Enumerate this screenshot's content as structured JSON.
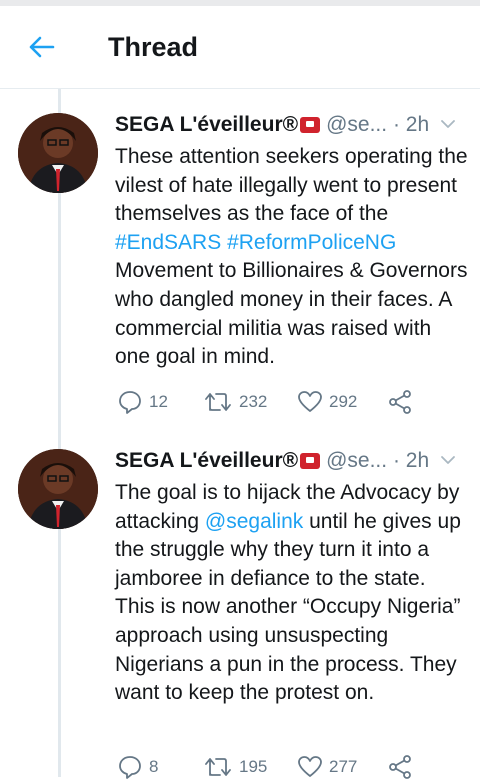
{
  "header": {
    "title": "Thread"
  },
  "tweets": [
    {
      "name": "SEGA L'éveilleur®",
      "handle": "@se...",
      "time": "· 2h",
      "body": [
        {
          "text": "These attention seekers operating the vilest of hate illegally went to present themselves as the face of the "
        },
        {
          "text": "#EndSARS #ReformPoliceNG",
          "link": true
        },
        {
          "text": " Movement to Billionaires & Governors who dangled money in their faces. A commercial militia was raised with one goal in mind."
        }
      ],
      "replies": "12",
      "retweets": "232",
      "likes": "292"
    },
    {
      "name": "SEGA L'éveilleur®",
      "handle": "@se...",
      "time": "· 2h",
      "body": [
        {
          "text": "The goal is to hijack the Advocacy by attacking "
        },
        {
          "text": "@segalink",
          "link": true
        },
        {
          "text": " until he gives up the struggle why they turn it into a jamboree in defiance to the state. This is now another “Occupy Nigeria” approach  using unsuspecting Nigerians a pun in the process. They want to keep the protest on."
        }
      ],
      "replies": "8",
      "retweets": "195",
      "likes": "277"
    }
  ],
  "icons": {
    "back": "arrow-left-icon",
    "caret": "chevron-down-icon",
    "reply": "reply-icon",
    "retweet": "retweet-icon",
    "like": "heart-icon",
    "share": "share-icon"
  },
  "colors": {
    "accent": "#1da1f2",
    "muted": "#657786",
    "text": "#14171a"
  }
}
